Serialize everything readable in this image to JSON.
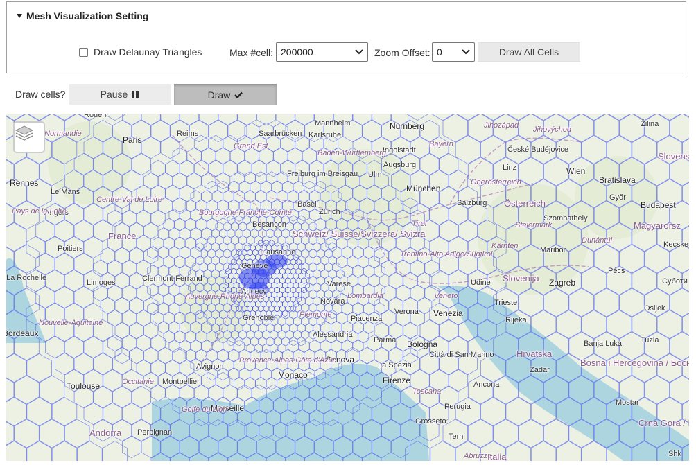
{
  "panel": {
    "title": "Mesh Visualization Setting",
    "checkbox_label": "Draw Delaunay Triangles",
    "checkbox_checked": false,
    "max_cell_label": "Max #cell:",
    "max_cell_value": "200000",
    "zoom_offset_label": "Zoom Offset:",
    "zoom_offset_value": "0",
    "draw_all_label": "Draw All Cells"
  },
  "draw_controls": {
    "question": "Draw cells?",
    "pause_label": "Pause",
    "draw_label": "Draw",
    "active": "draw"
  },
  "map": {
    "colors": {
      "land": "#edf1e4",
      "sea": "#aad3df",
      "mesh": "#5b6cf0",
      "dense": "#2c3cf0",
      "border": "#c09ac0"
    },
    "places": [
      {
        "name": "Rouen",
        "type": "city"
      },
      {
        "name": "Normandie",
        "type": "region"
      },
      {
        "name": "Reims",
        "type": "city"
      },
      {
        "name": "Paris",
        "type": "big"
      },
      {
        "name": "Grand Est",
        "type": "region"
      },
      {
        "name": "Saarbrücken",
        "type": "city"
      },
      {
        "name": "Mannheim",
        "type": "city"
      },
      {
        "name": "Karlsruhe",
        "type": "city"
      },
      {
        "name": "Nürnberg",
        "type": "big"
      },
      {
        "name": "Jihozápad",
        "type": "region"
      },
      {
        "name": "Jihovýchod",
        "type": "region"
      },
      {
        "name": "Žilina",
        "type": "city"
      },
      {
        "name": "Bayern",
        "type": "region"
      },
      {
        "name": "Ingolstadt",
        "type": "city"
      },
      {
        "name": "České Budějovice",
        "type": "city"
      },
      {
        "name": "Baden-Württemberg",
        "type": "region"
      },
      {
        "name": "Augsburg",
        "type": "city"
      },
      {
        "name": "Ulm",
        "type": "city"
      },
      {
        "name": "Linz",
        "type": "city"
      },
      {
        "name": "Wien",
        "type": "big"
      },
      {
        "name": "Slovens",
        "type": "country"
      },
      {
        "name": "Rennes",
        "type": "big"
      },
      {
        "name": "Le Mans",
        "type": "city"
      },
      {
        "name": "Freiburg im Breisgau",
        "type": "city"
      },
      {
        "name": "München",
        "type": "big"
      },
      {
        "name": "Oberösterreich",
        "type": "region"
      },
      {
        "name": "Bratislava",
        "type": "big"
      },
      {
        "name": "Győr",
        "type": "city"
      },
      {
        "name": "Centre-Val de Loire",
        "type": "region"
      },
      {
        "name": "Basel",
        "type": "city"
      },
      {
        "name": "Salzburg",
        "type": "city"
      },
      {
        "name": "Österreich",
        "type": "country"
      },
      {
        "name": "Budapest",
        "type": "big"
      },
      {
        "name": "Angers",
        "type": "city"
      },
      {
        "name": "Pays de la Loire",
        "type": "region"
      },
      {
        "name": "Zürich",
        "type": "city"
      },
      {
        "name": "Bourgogne-Franche-Comté",
        "type": "region"
      },
      {
        "name": "Besançon",
        "type": "city"
      },
      {
        "name": "Tirol",
        "type": "region"
      },
      {
        "name": "Steiermark",
        "type": "region"
      },
      {
        "name": "Szombathely",
        "type": "city"
      },
      {
        "name": "Magyarorsz",
        "type": "country"
      },
      {
        "name": "France",
        "type": "country"
      },
      {
        "name": "Schweiz/ Suisse/Svizzera/ Svizra",
        "type": "country"
      },
      {
        "name": "Dunántúl",
        "type": "region"
      },
      {
        "name": "Poitiers",
        "type": "city"
      },
      {
        "name": "Lausanne",
        "type": "city"
      },
      {
        "name": "Kärnten",
        "type": "region"
      },
      {
        "name": "Maribor",
        "type": "city"
      },
      {
        "name": "Kecsken",
        "type": "city"
      },
      {
        "name": "Trentino-Alto Adige/Südtirol",
        "type": "region"
      },
      {
        "name": "Genève",
        "type": "city"
      },
      {
        "name": "La Rochelle",
        "type": "city"
      },
      {
        "name": "Clermont-Ferrand",
        "type": "city"
      },
      {
        "name": "Limoges",
        "type": "city"
      },
      {
        "name": "Slovenija",
        "type": "country"
      },
      {
        "name": "Pécs",
        "type": "city"
      },
      {
        "name": "Udine",
        "type": "city"
      },
      {
        "name": "Zagreb",
        "type": "big"
      },
      {
        "name": "Суботи",
        "type": "city"
      },
      {
        "name": "Varese",
        "type": "city"
      },
      {
        "name": "Annecy",
        "type": "city"
      },
      {
        "name": "Veneto",
        "type": "region"
      },
      {
        "name": "Trieste",
        "type": "city"
      },
      {
        "name": "Auvergne-Rhône-Alpes",
        "type": "region"
      },
      {
        "name": "Novara",
        "type": "city"
      },
      {
        "name": "Lombardia",
        "type": "region"
      },
      {
        "name": "Verona",
        "type": "city"
      },
      {
        "name": "Venezia",
        "type": "big"
      },
      {
        "name": "Osijek",
        "type": "city"
      },
      {
        "name": "Grenoble",
        "type": "city"
      },
      {
        "name": "Piemonte",
        "type": "region"
      },
      {
        "name": "Piacenza",
        "type": "city"
      },
      {
        "name": "Rijeka",
        "type": "city"
      },
      {
        "name": "Nouvelle-Aquitaine",
        "type": "region"
      },
      {
        "name": "Bordeaux",
        "type": "big"
      },
      {
        "name": "Alessandria",
        "type": "city"
      },
      {
        "name": "Parma",
        "type": "city"
      },
      {
        "name": "Bologna",
        "type": "big"
      },
      {
        "name": "Banja Luka",
        "type": "city"
      },
      {
        "name": "Tuzla",
        "type": "city"
      },
      {
        "name": "Hrvatska",
        "type": "country"
      },
      {
        "name": "Avignon",
        "type": "city"
      },
      {
        "name": "Genova",
        "type": "big"
      },
      {
        "name": "Città di San Marino",
        "type": "city"
      },
      {
        "name": "Provence-Alpes-Côte d'Azur",
        "type": "region"
      },
      {
        "name": "La Spezia",
        "type": "city"
      },
      {
        "name": "Bosna i Hercegovina / Босна и Херцеговина",
        "type": "country"
      },
      {
        "name": "Zadar",
        "type": "city"
      },
      {
        "name": "Toulouse",
        "type": "big"
      },
      {
        "name": "Occitanie",
        "type": "region"
      },
      {
        "name": "Montpellier",
        "type": "city"
      },
      {
        "name": "Monaco",
        "type": "big"
      },
      {
        "name": "Firenze",
        "type": "big"
      },
      {
        "name": "Ancona",
        "type": "city"
      },
      {
        "name": "Toscana",
        "type": "region"
      },
      {
        "name": "Mostar",
        "type": "city"
      },
      {
        "name": "Marseille",
        "type": "big"
      },
      {
        "name": "Golfe du Lion",
        "type": "region"
      },
      {
        "name": "Perugia",
        "type": "city"
      },
      {
        "name": "Andorra",
        "type": "country"
      },
      {
        "name": "Perpignan",
        "type": "city"
      },
      {
        "name": "Grosseto",
        "type": "city"
      },
      {
        "name": "Crna Gora / Црна Гора",
        "type": "country"
      },
      {
        "name": "Terni",
        "type": "city"
      },
      {
        "name": "Abruzzo",
        "type": "region"
      },
      {
        "name": "Italia",
        "type": "country"
      },
      {
        "name": "Shk",
        "type": "city"
      }
    ]
  }
}
